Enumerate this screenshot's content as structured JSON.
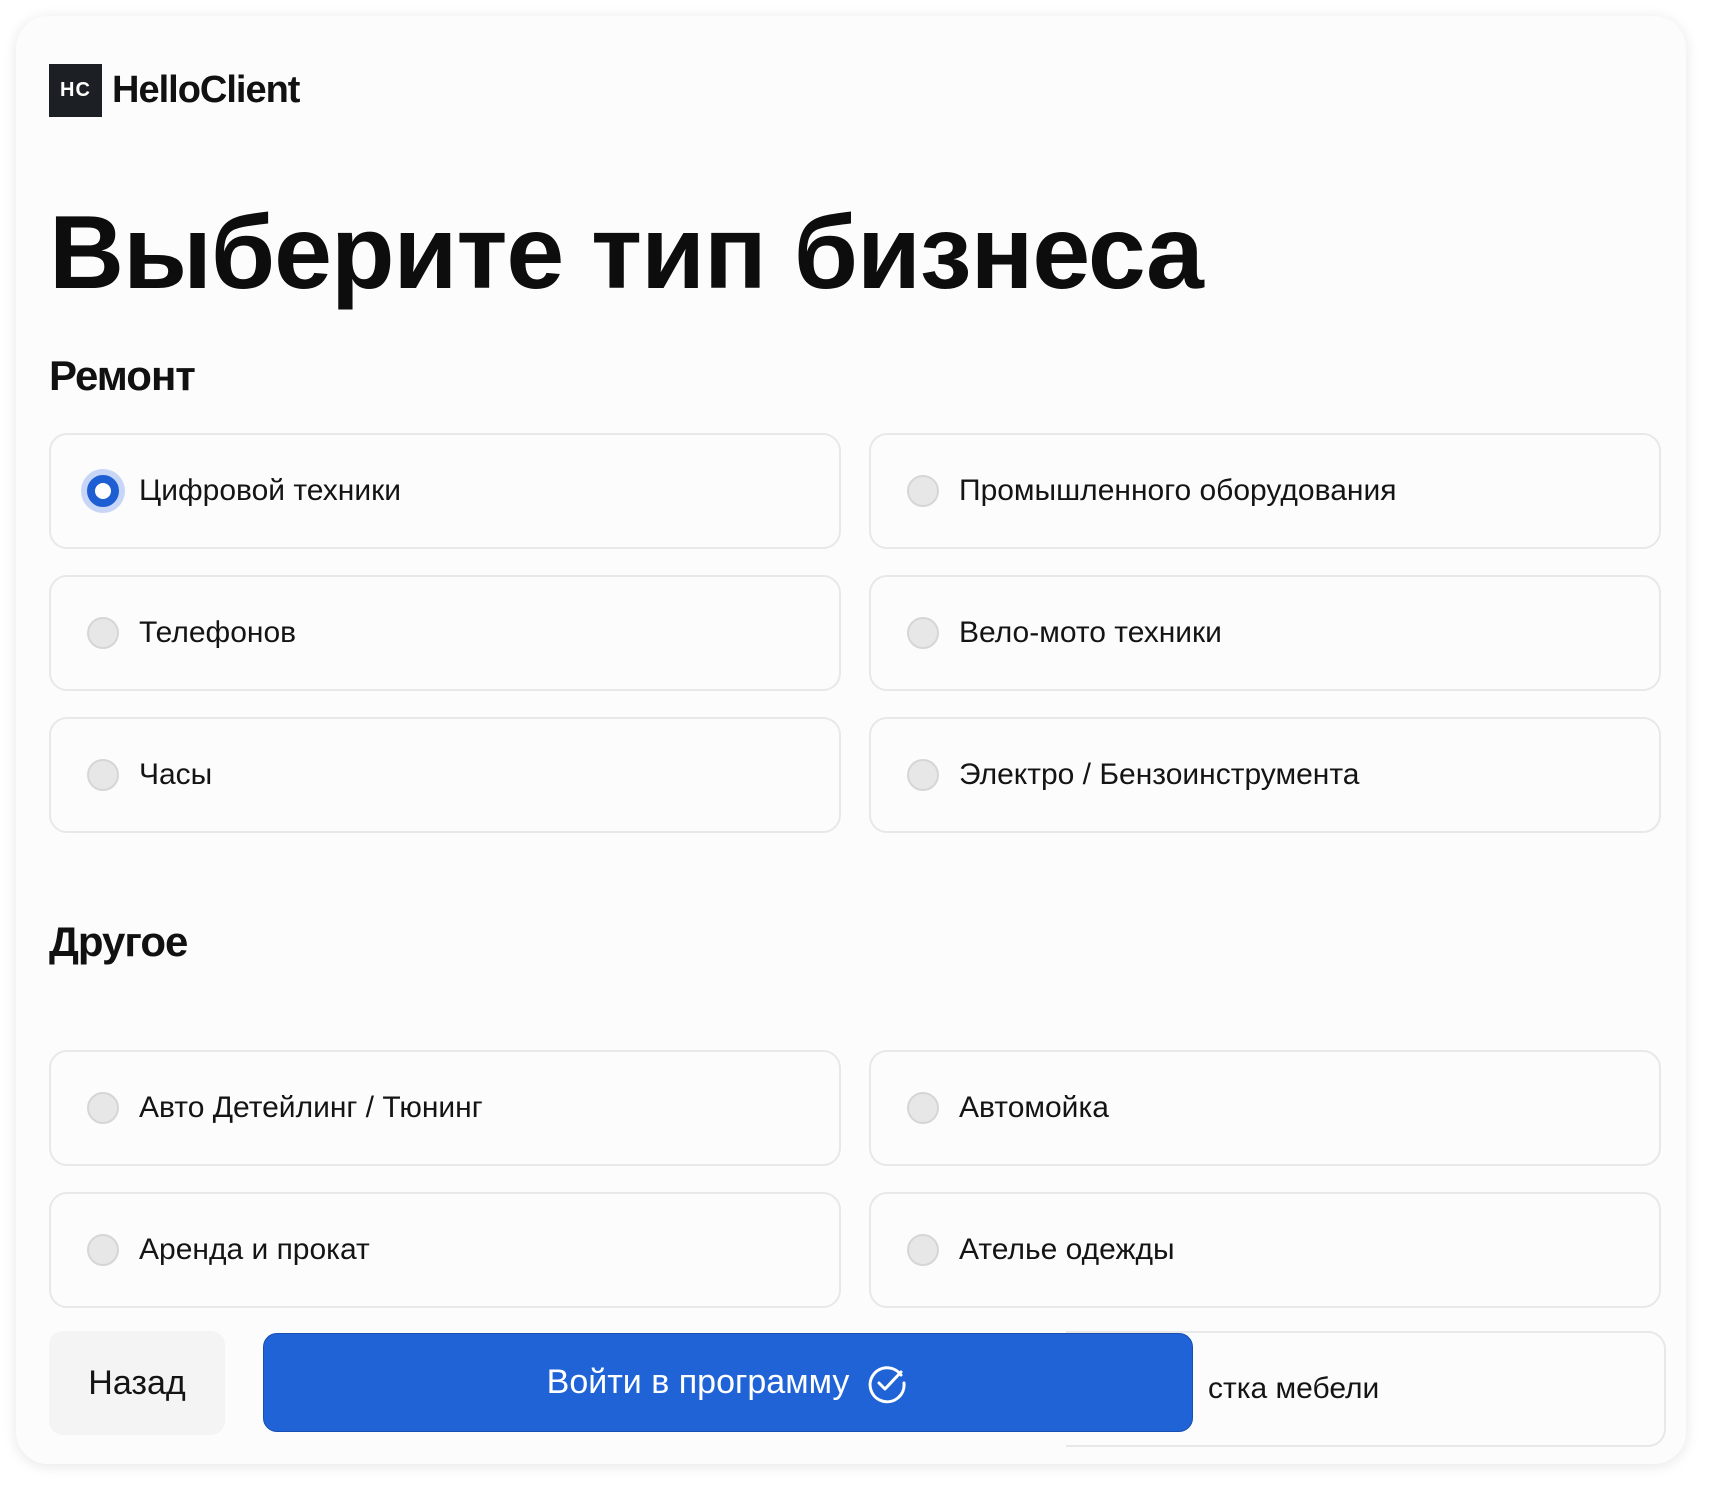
{
  "brand": {
    "mark": "HC",
    "name": "HelloClient"
  },
  "page_title": "Выберите тип бизнеса",
  "sections": [
    {
      "title": "Ремонт",
      "options": [
        {
          "label": "Цифровой техники",
          "selected": true
        },
        {
          "label": "Промышленного оборудования",
          "selected": false
        },
        {
          "label": "Телефонов",
          "selected": false
        },
        {
          "label": "Вело-мото техники",
          "selected": false
        },
        {
          "label": "Часы",
          "selected": false
        },
        {
          "label": "Электро / Бензоинструмента",
          "selected": false
        }
      ]
    },
    {
      "title": "Другое",
      "options": [
        {
          "label": "Авто Детейлинг / Тюнинг",
          "selected": false
        },
        {
          "label": "Автомойка",
          "selected": false
        },
        {
          "label": "Аренда и прокат",
          "selected": false
        },
        {
          "label": "Ателье одежды",
          "selected": false
        }
      ],
      "partially_hidden_option": "стка мебели"
    }
  ],
  "footer": {
    "back_label": "Назад",
    "submit_label": "Войти в программу",
    "submit_icon": "check-circle-icon"
  },
  "colors": {
    "accent": "#1f63d6",
    "radio_ring": "#c7d5f7",
    "logo_bg": "#1c2024"
  }
}
